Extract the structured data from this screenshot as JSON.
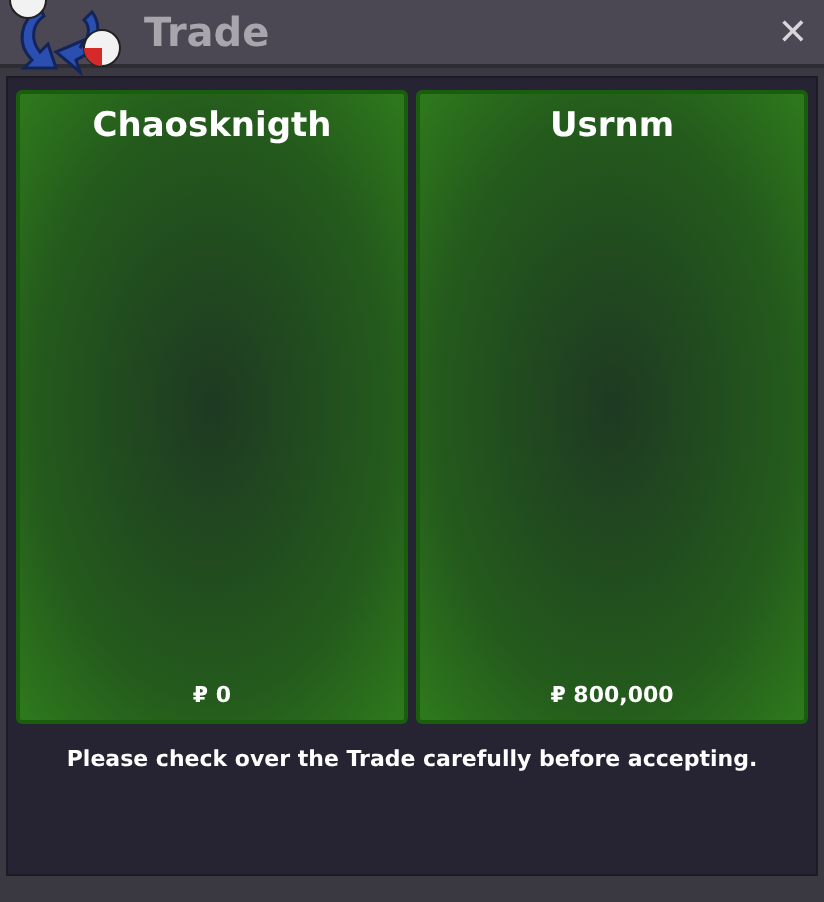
{
  "window": {
    "title": "Trade",
    "close": "✕"
  },
  "offers": [
    {
      "name": "Chaosknigth",
      "money": "₽ 0"
    },
    {
      "name": "Usrnm",
      "money": "₽ 800,000"
    }
  ],
  "notice": "Please check over the Trade carefully before accepting."
}
